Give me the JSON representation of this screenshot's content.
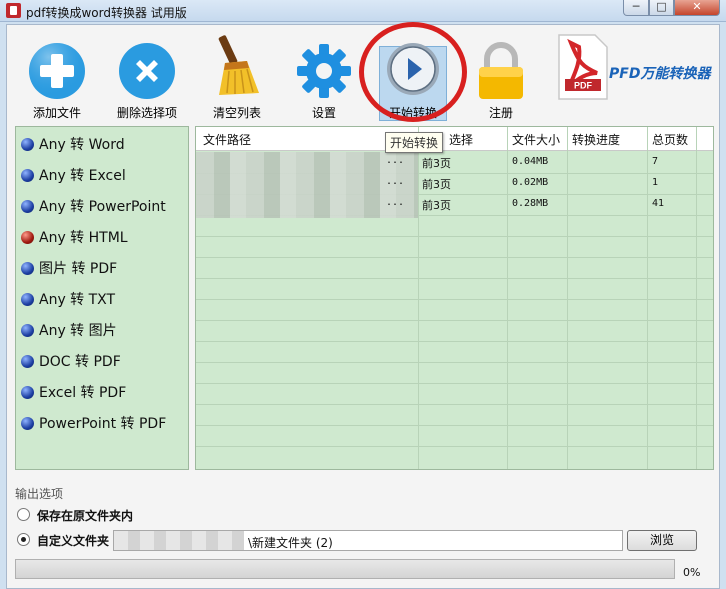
{
  "window": {
    "title": "pdf转换成word转换器 试用版",
    "controls": [
      "─",
      "□",
      "✕"
    ]
  },
  "toolbar": {
    "items": [
      {
        "label": "添加文件",
        "icon": "add-icon"
      },
      {
        "label": "删除选择项",
        "icon": "delete-icon"
      },
      {
        "label": "清空列表",
        "icon": "broom-icon"
      },
      {
        "label": "设置",
        "icon": "gear-icon"
      },
      {
        "label": "开始转换",
        "icon": "play-icon"
      },
      {
        "label": "注册",
        "icon": "lock-icon"
      }
    ],
    "brand": "PFD万能转换器",
    "pdf_logo_text": "PDF",
    "tooltip": "开始转换"
  },
  "conversions": [
    {
      "label": "Any 转 Word",
      "selected": false
    },
    {
      "label": "Any 转 Excel",
      "selected": false
    },
    {
      "label": "Any 转 PowerPoint",
      "selected": false
    },
    {
      "label": "Any 转 HTML",
      "selected": true
    },
    {
      "label": "图片 转 PDF",
      "selected": false
    },
    {
      "label": "Any 转 TXT",
      "selected": false
    },
    {
      "label": "Any 转 图片",
      "selected": false
    },
    {
      "label": "DOC 转 PDF",
      "selected": false
    },
    {
      "label": "Excel 转 PDF",
      "selected": false
    },
    {
      "label": "PowerPoint 转 PDF",
      "selected": false
    }
  ],
  "table": {
    "columns": [
      "文件路径",
      "选择",
      "文件大小",
      "转换进度",
      "总页数"
    ],
    "rows": [
      {
        "path_tail": "...",
        "pages_sel": "前3页",
        "size": "0.04MB",
        "progress": "",
        "total": "7"
      },
      {
        "path_tail": "...",
        "pages_sel": "前3页",
        "size": "0.02MB",
        "progress": "",
        "total": "1"
      },
      {
        "path_tail": "...",
        "pages_sel": "前3页",
        "size": "0.28MB",
        "progress": "",
        "total": "41"
      }
    ]
  },
  "output": {
    "title": "输出选项",
    "option_original": "保存在原文件夹内",
    "option_custom": "自定义文件夹",
    "selected": "custom",
    "path_visible": "\\新建文件夹 (2)",
    "browse_label": "浏览",
    "progress_percent": 0,
    "progress_text": "0%"
  },
  "colors": {
    "panel_green": "#cfe9cf",
    "accent_blue": "#1a63b8",
    "highlight_red": "#d8201f"
  }
}
